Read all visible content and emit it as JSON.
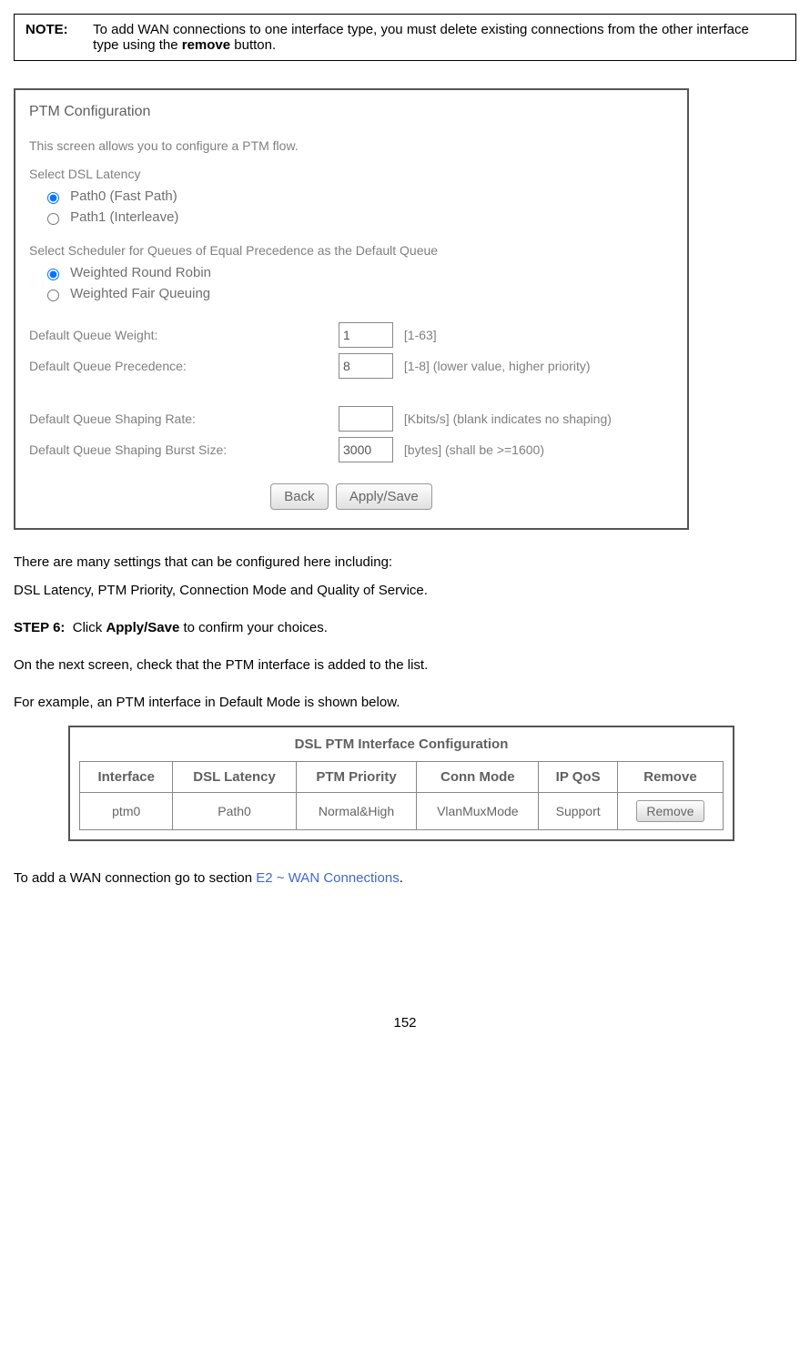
{
  "note": {
    "label": "NOTE:",
    "text_start": "To add WAN connections to one interface type, you must delete existing connections from the other interface type using the ",
    "bold_word": "remove",
    "text_end": " button."
  },
  "ptm": {
    "title": "PTM Configuration",
    "desc": "This screen allows you to configure a PTM flow.",
    "latency_label": "Select DSL Latency",
    "path0": "Path0 (Fast Path)",
    "path1": "Path1 (Interleave)",
    "scheduler_label": "Select Scheduler for Queues of Equal Precedence as the Default Queue",
    "wrr": "Weighted Round Robin",
    "wfq": "Weighted Fair Queuing",
    "fields": {
      "weight_label": "Default Queue Weight:",
      "weight_value": "1",
      "weight_hint": "[1-63]",
      "prec_label": "Default Queue Precedence:",
      "prec_value": "8",
      "prec_hint": "[1-8] (lower value, higher priority)",
      "rate_label": "Default Queue Shaping Rate:",
      "rate_value": "",
      "rate_hint": "[Kbits/s] (blank indicates no shaping)",
      "burst_label": "Default Queue Shaping Burst Size:",
      "burst_value": "3000",
      "burst_hint": "[bytes] (shall be >=1600)"
    },
    "back_btn": "Back",
    "apply_btn": "Apply/Save"
  },
  "para1": "There are many settings that can be configured here including:",
  "para2": "DSL Latency, PTM Priority, Connection Mode and Quality of Service.",
  "step6": {
    "label": "STEP 6:",
    "text_start": "Click ",
    "bold": "Apply/Save",
    "text_end": " to confirm your choices."
  },
  "para3": "On the next screen, check that the PTM interface is added to the list.",
  "para4": "For example, an PTM interface in Default Mode is shown below.",
  "dsl_table": {
    "title": "DSL PTM Interface Configuration",
    "headers": [
      "Interface",
      "DSL Latency",
      "PTM Priority",
      "Conn Mode",
      "IP QoS",
      "Remove"
    ],
    "row": {
      "interface": "ptm0",
      "latency": "Path0",
      "priority": "Normal&High",
      "mode": "VlanMuxMode",
      "qos": "Support",
      "remove_btn": "Remove"
    }
  },
  "final": {
    "text_start": "To add a WAN connection go to section ",
    "link": "E2 ~ WAN Connections",
    "text_end": "."
  },
  "page_number": "152"
}
